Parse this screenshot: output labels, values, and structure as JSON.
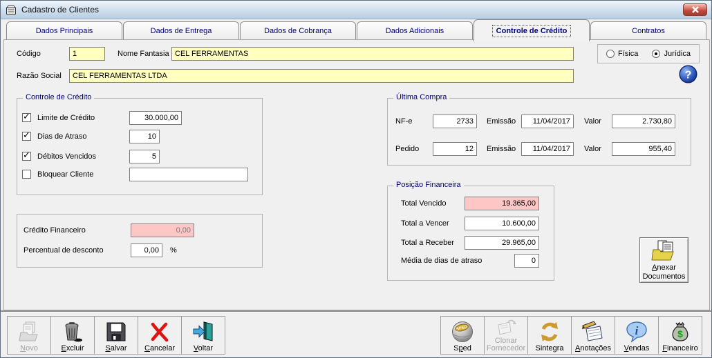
{
  "window": {
    "title": "Cadastro de Clientes"
  },
  "tabs": [
    {
      "label": "Dados Principais"
    },
    {
      "label": "Dados de Entrega"
    },
    {
      "label": "Dados de Cobrança"
    },
    {
      "label": "Dados Adicionais"
    },
    {
      "label": "Controle de Crédito",
      "active": true
    },
    {
      "label": "Contratos"
    }
  ],
  "header": {
    "codigo_label": "Código",
    "codigo_value": "1",
    "nome_fantasia_label": "Nome Fantasia",
    "nome_fantasia_value": "CEL FERRAMENTAS",
    "razao_social_label": "Razão Social",
    "razao_social_value": "CEL FERRAMENTAS LTDA",
    "pessoa": {
      "fisica_label": "Física",
      "juridica_label": "Jurídica",
      "fisica_checked": false,
      "juridica_checked": true
    }
  },
  "controle_credito": {
    "title": "Controle de Crédito",
    "rows": [
      {
        "label": "Limite de Crédito",
        "checked": true,
        "value": "30.000,00"
      },
      {
        "label": "Dias de Atraso",
        "checked": true,
        "value": "10"
      },
      {
        "label": "Débitos Vencidos",
        "checked": true,
        "value": "5"
      },
      {
        "label": "Bloquear Cliente",
        "checked": false,
        "value": ""
      }
    ]
  },
  "credito_financeiro": {
    "credito_label": "Crédito Financeiro",
    "credito_value": "0,00",
    "desconto_label": "Percentual de desconto",
    "desconto_value": "0,00",
    "percent_suffix": "%"
  },
  "ultima_compra": {
    "title": "Última Compra",
    "rows": [
      {
        "doc_label": "NF-e",
        "doc_value": "2733",
        "emissao_label": "Emissão",
        "emissao_value": "11/04/2017",
        "valor_label": "Valor",
        "valor_value": "2.730,80"
      },
      {
        "doc_label": "Pedido",
        "doc_value": "12",
        "emissao_label": "Emissão",
        "emissao_value": "11/04/2017",
        "valor_label": "Valor",
        "valor_value": "955,40"
      }
    ]
  },
  "posicao_financeira": {
    "title": "Posição Financeira",
    "vencido_label": "Total Vencido",
    "vencido_value": "19.365,00",
    "vencer_label": "Total a Vencer",
    "vencer_value": "10.600,00",
    "receber_label": "Total a Receber",
    "receber_value": "29.965,00",
    "media_label": "Média de dias de atraso",
    "media_value": "0"
  },
  "anexar": {
    "line1": "Anexar",
    "line2": "Documentos",
    "accel": 0
  },
  "toolbar": {
    "left": [
      {
        "label": "Novo",
        "accel": 0,
        "disabled": true
      },
      {
        "label": "Excluir",
        "accel": 0
      },
      {
        "label": "Salvar",
        "accel": 0
      },
      {
        "label": "Cancelar",
        "accel": 0
      },
      {
        "label": "Voltar",
        "accel": 0
      }
    ],
    "right": [
      {
        "label": "Sped",
        "accel": 1
      },
      {
        "label": "Clonar Fornecedor",
        "disabled": true
      },
      {
        "label": "Sintegra"
      },
      {
        "label": "Anotações",
        "accel": 0
      },
      {
        "label": "Vendas",
        "accel": 0
      },
      {
        "label": "Financeiro",
        "accel": 0
      }
    ]
  },
  "icons": {
    "window": "file-cabinet",
    "close": "x",
    "help": "?",
    "novo": "documents-gray",
    "excluir": "trash-can",
    "salvar": "floppy-disk",
    "cancelar": "red-x",
    "voltar": "exit-door-arrow",
    "sped": "gray-sphere-sped",
    "clonar": "copy-sheets-gray",
    "sintegra": "gold-circular-arrows",
    "anotacoes": "notepad-pencil",
    "vendas": "blue-info-bubble",
    "financeiro": "money-bag-dollar",
    "anexar": "folder-documents"
  },
  "colors": {
    "accent_navy": "#000080",
    "field_yellow": "#ffffc0",
    "field_pink": "#ffc6c6",
    "titlebar_blue": "#b8cee3",
    "close_red": "#bd4a3c",
    "background": "#f0f0f0"
  }
}
